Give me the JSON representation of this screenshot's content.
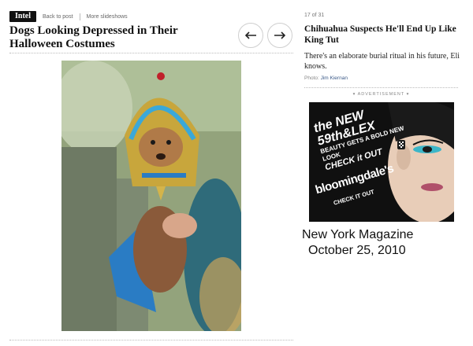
{
  "header": {
    "logo_text": "Intel",
    "back_link": "Back to post",
    "slideshows_link": "More slideshows"
  },
  "article": {
    "title": "Dogs Looking Depressed in Their Halloween Costumes"
  },
  "nav": {
    "prev_icon": "arrow-left-icon",
    "next_icon": "arrow-right-icon"
  },
  "slide": {
    "counter": "17 of 31",
    "title": "Chihuahua Suspects He'll End Up Like King Tut",
    "caption": "There's an elaborate burial ritual in his future, Eli knows.",
    "credit_prefix": "Photo:",
    "credit_name": "Jim Kiernan"
  },
  "advertisement": {
    "label": "ADVERTISEMENT",
    "line1": "the NEW 59th&LEX",
    "line2": "BEAUTY GETS A BOLD NEW LOOK",
    "line3": "CHECK it OUT",
    "brand": "bloomingdale's",
    "cta": "CHECK IT OUT"
  },
  "annotation": {
    "line1": "New York Magazine",
    "line2": "October 25, 2010"
  },
  "colors": {
    "link": "#3b5a88",
    "logo_bg": "#111111"
  }
}
